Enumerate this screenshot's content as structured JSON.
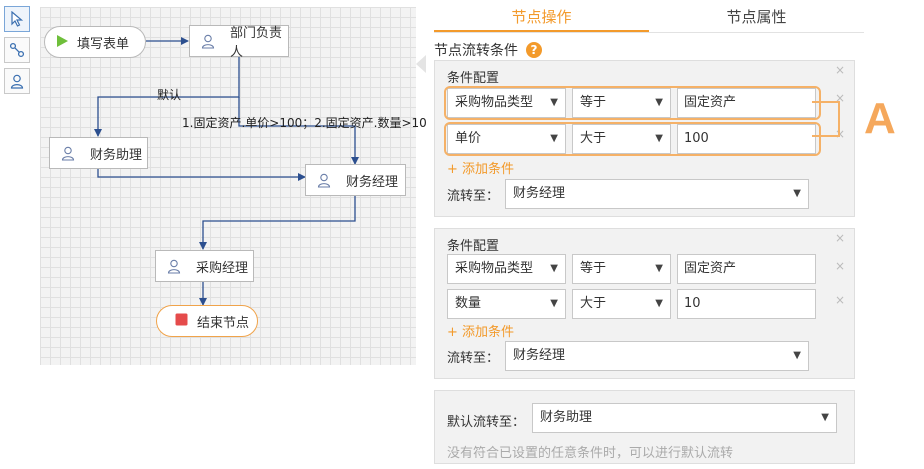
{
  "toolbar": {
    "tools": [
      {
        "icon": "pointer-icon"
      },
      {
        "icon": "connector-icon"
      },
      {
        "icon": "user-icon"
      }
    ]
  },
  "canvas": {
    "nodes": {
      "start": "填写表单",
      "dept_head": "部门负责人",
      "finance_assistant": "财务助理",
      "finance_manager": "财务经理",
      "purchase_manager": "采购经理",
      "end": "结束节点"
    },
    "labels": {
      "default": "默认",
      "condition": "1.固定资产.单价>100；2.固定资产.数量>10"
    },
    "colors": {
      "wire": "#2c4f8f",
      "start_icon": "#6fbf3b",
      "end_icon": "#e54b4b"
    }
  },
  "panel": {
    "tabs": [
      "节点操作",
      "节点属性"
    ],
    "active_tab": 0,
    "section_title": "节点流转条件",
    "help_symbol": "?",
    "condition_groups": [
      {
        "title": "条件配置",
        "close_symbol": "×",
        "rows": [
          {
            "field": "采购物品类型",
            "operator": "等于",
            "value": "固定资产",
            "close_symbol": "×"
          },
          {
            "field": "单价",
            "operator": "大于",
            "value": "100",
            "close_symbol": "×"
          }
        ],
        "add_label": "+ 添加条件",
        "flow_to_label": "流转至：",
        "flow_to_value": "财务经理"
      },
      {
        "title": "条件配置",
        "close_symbol": "×",
        "rows": [
          {
            "field": "采购物品类型",
            "operator": "等于",
            "value": "固定资产",
            "close_symbol": "×"
          },
          {
            "field": "数量",
            "operator": "大于",
            "value": "10",
            "close_symbol": "×"
          }
        ],
        "add_label": "+ 添加条件",
        "flow_to_label": "流转至：",
        "flow_to_value": "财务经理"
      }
    ],
    "default_flow": {
      "label": "默认流转至：",
      "value": "财务助理",
      "note": "没有符合已设置的任意条件时，可以进行默认流转"
    },
    "annotation_letter": "A",
    "accent": "#f39a2b"
  }
}
